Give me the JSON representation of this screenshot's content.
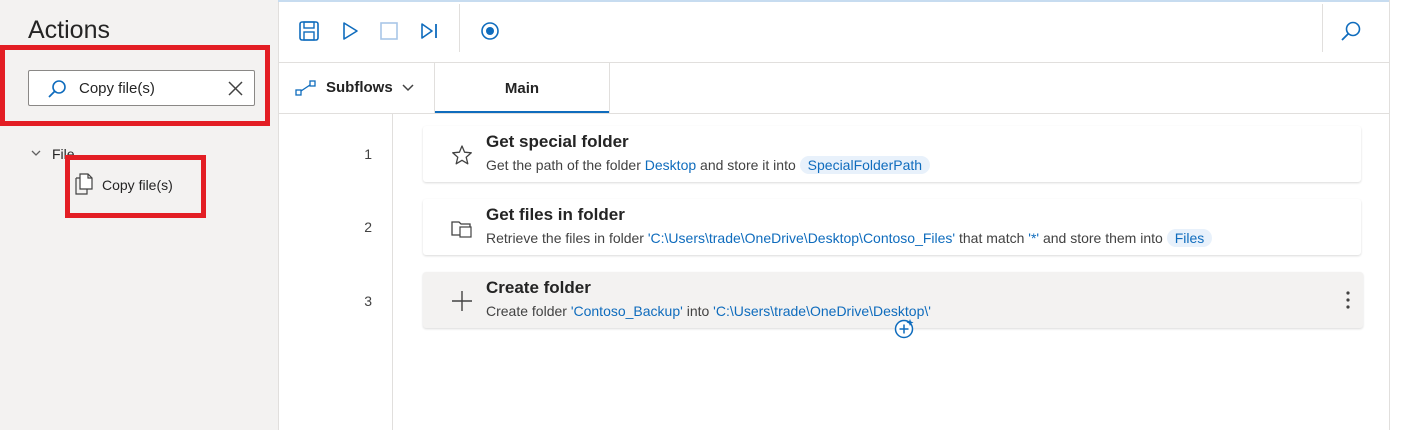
{
  "sidebar": {
    "title": "Actions",
    "search": {
      "value": "Copy file(s)"
    },
    "tree": {
      "group_label": "File",
      "items": [
        {
          "label": "Copy file(s)"
        }
      ]
    }
  },
  "tabs": {
    "subflows_label": "Subflows",
    "main_label": "Main"
  },
  "steps": [
    {
      "line": "1",
      "title": "Get special folder",
      "desc_prefix": "Get the path of the folder ",
      "desc_link": "Desktop",
      "desc_mid": " and store it into ",
      "desc_var": "SpecialFolderPath"
    },
    {
      "line": "2",
      "title": "Get files in folder",
      "desc_prefix": "Retrieve the files in folder ",
      "desc_link": "'C:\\Users\\trade\\OneDrive\\Desktop\\Contoso_Files'",
      "desc_mid": " that match ",
      "desc_link2": "'*'",
      "desc_mid2": " and store them into ",
      "desc_var": "Files"
    },
    {
      "line": "3",
      "title": "Create folder",
      "desc_prefix": "Create folder ",
      "desc_link": "'Contoso_Backup'",
      "desc_mid": " into ",
      "desc_link2": "'C:\\Users\\trade\\OneDrive\\Desktop\\'"
    }
  ],
  "colors": {
    "accent": "#0f6cbd",
    "highlight_box": "#e31e24"
  }
}
